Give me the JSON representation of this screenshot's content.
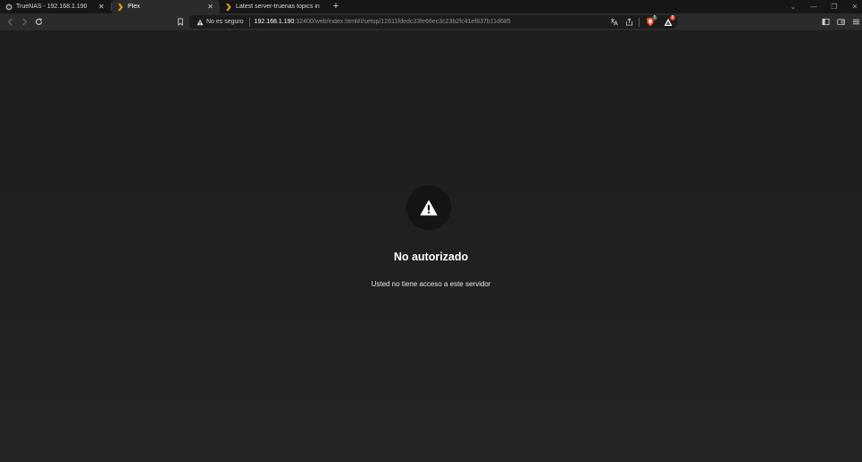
{
  "tabs": [
    {
      "title": "TrueNAS - 192.168.1.190",
      "icon": "truenas-icon",
      "active": false
    },
    {
      "title": "Plex",
      "icon": "plex-chevron-icon",
      "active": true
    },
    {
      "title": "Latest server-truenas topics in NAS &",
      "icon": "plex-chevron-icon",
      "active": false
    }
  ],
  "tab_close": "✕",
  "new_tab": "+",
  "window_controls": {
    "dropdown": "⌄",
    "minimize": "—",
    "restore": "❐",
    "close": "✕"
  },
  "address_bar": {
    "security_label": "No es seguro",
    "host": "192.168.1.190",
    "rest": ":32400/web/index.html#!/setup/12611fdedc33fe66ec3c23b2fc41ef837b11d685"
  },
  "brave_shield_badge": "5",
  "rewards_badge": "8",
  "page": {
    "title": "No autorizado",
    "message": "Usted no tiene acceso a este servidor"
  },
  "colors": {
    "accent_plex": "#e5a00d",
    "brave_orange": "#fb542b",
    "background": "#1f1f1f"
  }
}
